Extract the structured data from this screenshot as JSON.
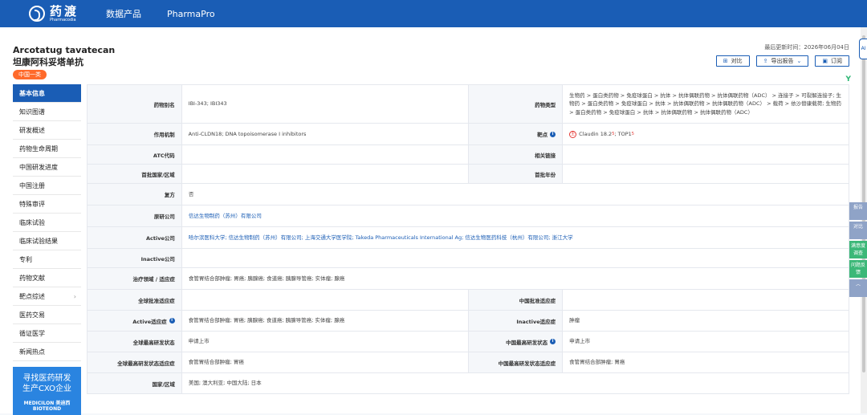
{
  "header": {
    "logo_cn": "药渡",
    "logo_en": "Pharmacodia",
    "nav": [
      "数据产品",
      "PharmaPro"
    ]
  },
  "drug": {
    "name_en": "Arcotatug tavatecan",
    "name_cn": "坦康阿科妥塔单抗",
    "badge": "中国一类",
    "updated": "最后更新时间：2026年06月04日",
    "actions": {
      "compare": "对比",
      "export": "导出报告",
      "subscribe": "订阅"
    }
  },
  "ai_label": "AI",
  "sidebar": {
    "items": [
      "基本信息",
      "知识图谱",
      "研发概述",
      "药物生命周期",
      "中国研发进度",
      "中国注册",
      "特殊审评",
      "临床试验",
      "临床试验结果",
      "专利",
      "药物文献",
      "靶点综述",
      "医药交易",
      "循证医学",
      "新闻热点"
    ],
    "promo_line1": "寻找医药研发",
    "promo_line2": "生产CXO企业",
    "promo_brand": "MEDICILON 美迪西 BIOTEOND"
  },
  "table": {
    "alias_label": "药物别名",
    "alias": "IBI-343; IBI343",
    "type_label": "药物类型",
    "type": "生物药 > 蛋白类药物 > 免疫球蛋白 > 抗体 > 抗体偶联药物 > 抗体偶联药物（ADC） > 连接子 > 可裂解连接子; 生物药 > 蛋白类药物 > 免疫球蛋白 > 抗体 > 抗体偶联药物 > 抗体偶联药物（ADC） > 载荷 > 依沙替康载荷; 生物药 > 蛋白类药物 > 免疫球蛋白 > 抗体 > 抗体偶联药物 > 抗体偶联药物（ADC）",
    "mechanism_label": "作用机制",
    "mechanism": "Anti-CLDN18; DNA topoisomerase I inhibitors",
    "target_label": "靶点",
    "target_icon": "主",
    "target1": "Claudin 18.2",
    "target_sup": "5",
    "target_sep": "; TOP1",
    "target_sup2": "5",
    "atc_label": "ATC代码",
    "related_label": "相关链接",
    "first_country_label": "首批国家/区域",
    "first_year_label": "首批年份",
    "compound_label": "复方",
    "compound": "否",
    "originator_label": "原研公司",
    "originator": "信达生物制药（苏州）有限公司",
    "active_co_label": "Active公司",
    "active_co": "哈尔滨医科大学; 信达生物制药（苏州）有限公司; 上海交通大学医学院; Takeda Pharmaceuticals International Ag; 信达生物医药科技（杭州）有限公司; 浙江大学",
    "inactive_co_label": "Inactive公司",
    "area_label": "治疗领域 / 适应症",
    "area": "食管胃结合部肿瘤; 胃癌; 胰腺癌; 食道癌; 胰腺导管癌; 实体瘤; 腺癌",
    "global_approved_label": "全球批准适应症",
    "china_approved_label": "中国批准适应症",
    "active_ind_label": "Active适应症",
    "active_ind": "食管胃结合部肿瘤; 胃癌; 胰腺癌; 食道癌; 胰腺导管癌; 实体瘤; 腺癌",
    "inactive_ind_label": "Inactive适应症",
    "inactive_ind": "肿瘤",
    "global_status_label": "全球最高研发状态",
    "global_status": "申请上市",
    "china_status_label": "中国最高研发状态",
    "china_status": "申请上市",
    "global_status_ind_label": "全球最高研发状态适应症",
    "global_status_ind": "食管胃结合部肿瘤; 胃癌",
    "china_status_ind_label": "中国最高研发状态适应症",
    "china_status_ind": "食管胃结合部肿瘤; 胃癌",
    "country_label": "国家/区域",
    "country": "美国; 澳大利亚; 中国大陆; 日本"
  },
  "float_tools": [
    "报告",
    "对比",
    "满意度调查",
    "问题反馈"
  ]
}
